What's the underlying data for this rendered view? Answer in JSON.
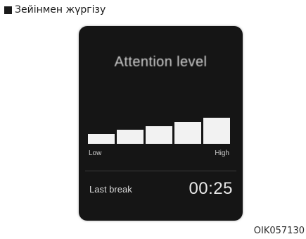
{
  "caption": "Зейінмен жүргізу",
  "screen": {
    "title": "Attention level",
    "level": {
      "segments": 5,
      "filled": 5,
      "value": 1.0
    },
    "label_low": "Low",
    "label_high": "High",
    "last_break_label": "Last break",
    "last_break_time": "00:25"
  },
  "image_code": "OIK057130"
}
